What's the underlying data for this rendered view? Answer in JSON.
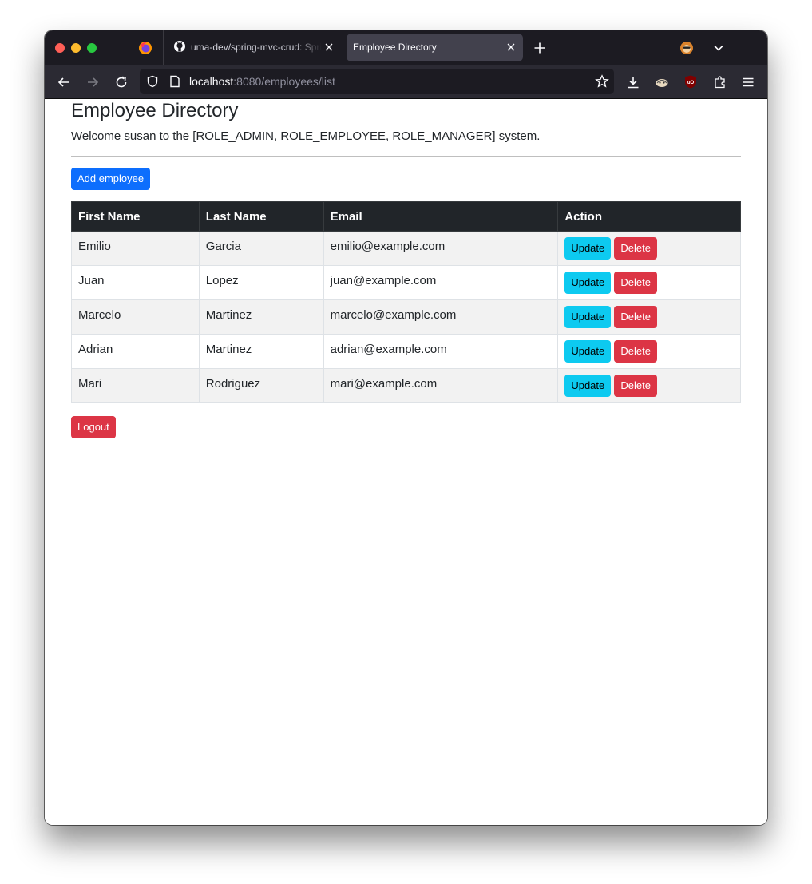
{
  "browser": {
    "tabs": [
      {
        "title": "uma-dev/spring-mvc-crud: Spring",
        "active": false
      },
      {
        "title": "Employee Directory",
        "active": true
      }
    ],
    "url_host": "localhost",
    "url_path": ":8080/employees/list"
  },
  "page": {
    "title": "Employee Directory",
    "welcome": "Welcome susan to the [ROLE_ADMIN, ROLE_EMPLOYEE, ROLE_MANAGER] system.",
    "add_button": "Add employee",
    "logout_button": "Logout",
    "table": {
      "headers": [
        "First Name",
        "Last Name",
        "Email",
        "Action"
      ],
      "rows": [
        {
          "first": "Emilio",
          "last": "Garcia",
          "email": "emilio@example.com"
        },
        {
          "first": "Juan",
          "last": "Lopez",
          "email": "juan@example.com"
        },
        {
          "first": "Marcelo",
          "last": "Martinez",
          "email": "marcelo@example.com"
        },
        {
          "first": "Adrian",
          "last": "Martinez",
          "email": "adrian@example.com"
        },
        {
          "first": "Mari",
          "last": "Rodriguez",
          "email": "mari@example.com"
        }
      ],
      "update_label": "Update",
      "delete_label": "Delete"
    }
  },
  "colors": {
    "primary": "#0d6efd",
    "info": "#0dcaf0",
    "danger": "#dc3545",
    "table_header": "#212529"
  }
}
